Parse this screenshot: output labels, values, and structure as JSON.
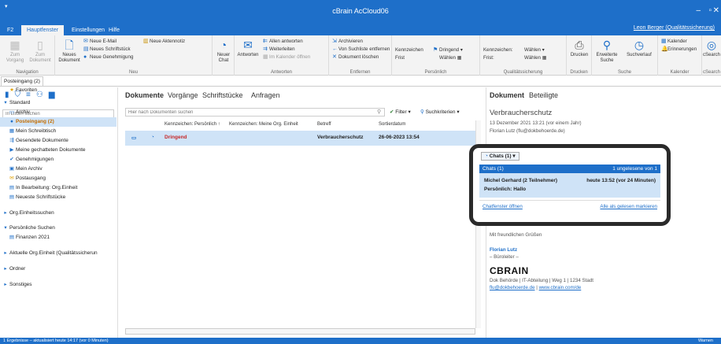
{
  "app": {
    "title": "cBrain AcCloud06",
    "user": "Leon Berger (Qualitätssicherung)"
  },
  "tabs": [
    "F2",
    "Hauptfenster",
    "Einstellungen",
    "Hilfe"
  ],
  "ribbon": {
    "navigation": {
      "zoom_back": "Zum Vorgang",
      "zoom_doc": "Zum Dokument",
      "label": "Navigation"
    },
    "neu": {
      "new_doc": "Neues Dokument",
      "new_mail": "Neue E-Mail",
      "new_item": "Neues Schriftstück",
      "new_approval": "Neue Genehmigung",
      "new_record": "Neue Aktennotiz",
      "label": "Neu"
    },
    "chat": {
      "new_chat": "Neuer Chat",
      "label": ""
    },
    "antworten": {
      "reply": "Antworten",
      "reply_all": "Allen antworten",
      "forward": "Weiterleiten",
      "calendar": "Im Kalender öffnen",
      "label": "Antworten"
    },
    "entfernen": {
      "archive": "Archivieren",
      "remove_list": "Von Suchliste entfernen",
      "delete": "Dokument löschen",
      "label": "Entfernen"
    },
    "persoenlich": {
      "kennz": "Kennzeichen",
      "frist": "Frist",
      "urgent": "Dringend",
      "choose": "Wählen",
      "label": "Persönlich"
    },
    "qualitaet": {
      "kennz": "Kennzeichen:",
      "frist": "Frist:",
      "choose1": "Wählen",
      "choose2": "Wählen",
      "label": "Qualitätssicherung"
    },
    "drucken": {
      "print": "Drucken",
      "label": "Drucken"
    },
    "suche": {
      "ext": "Erweiterte Suche",
      "suchverlauf": "Suchverlauf",
      "label": "Suche"
    },
    "kalender": {
      "cal": "Kalender",
      "reminders": "Erinnerungen",
      "label": "Kalender"
    },
    "csearch": {
      "csearch": "cSearch",
      "label": "cSearch"
    }
  },
  "doc_tab": "Posteingang (2)",
  "left": {
    "search_placeholder": "In Listen suchen",
    "items": [
      "Favoriten",
      "Standard",
      "Archiv",
      "Posteingang (2)",
      "Mein Schreibtisch",
      "Gesendete Dokumente",
      "Meine gechatteten Dokumente",
      "Genehmigungen",
      "Mein Archiv",
      "Postausgang",
      "In Bearbeitung: Org.Einheit",
      "Neueste Schriftstücke",
      "Org.Einheitssuchen",
      "Persönliche Suchen",
      "Finanzen 2021",
      "Aktuelle Org.Einheit (Qualitätssicherun",
      "Ordner",
      "Sonstiges"
    ]
  },
  "center": {
    "tabs": [
      "Dokumente",
      "Vorgänge",
      "Schriftstücke",
      "Anfragen"
    ],
    "search_placeholder": "Hier nach Dokumenten suchen",
    "filter": "Filter",
    "suchkriterien": "Suchkriterien",
    "headers": [
      "Kennzeichen: Persönlich",
      "Kennzeichen: Meine Org. Einheit",
      "Betreff",
      "Sortierdatum"
    ],
    "row": {
      "flag": "Dringend",
      "subject": "Verbraucherschutz",
      "date": "26-06-2023 13:54"
    }
  },
  "right": {
    "tabs": [
      "Dokument",
      "Beteiligte"
    ],
    "subject": "Verbraucherschutz",
    "date": "13 Dezember 2021 13:21 (vor einem Jahr)",
    "from": "Florian Lutz (flu@dokbehoerde.de)",
    "greeting": "Mit freundlichen Grüßen",
    "sig_name": "Florian Lutz",
    "sig_role": "– Büroleiter –",
    "logo": "CBRAIN",
    "address": "Dok Behörde | IT-Abteilung | Weg 1 | 1234 Stadt",
    "email": "flu@dokbehoerde.de",
    "web": "www.cbrain.com/de"
  },
  "chat": {
    "button": "Chats (1)",
    "header": "Chats (1)",
    "unread": "1 ungelesene von 1",
    "name": "Michel Gerhard (2 Teilnehmer)",
    "time": "heute 13:52 (vor 24 Minuten)",
    "msg": "Persönlich: Hallo",
    "open": "Chatfenster öffnen",
    "mark_read": "Alle als gelesen markieren"
  },
  "status": {
    "text": "1 Ergebnisse – aktualisiert heute 14:17 (vor 0 Minuten)",
    "right": "Warnen"
  }
}
